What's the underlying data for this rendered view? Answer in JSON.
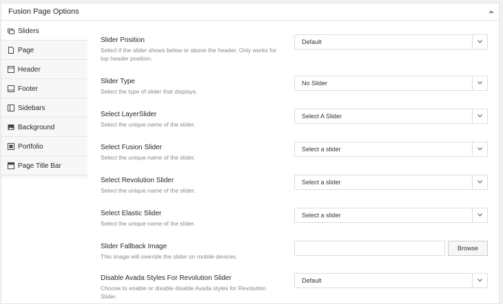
{
  "panel": {
    "title": "Fusion Page Options"
  },
  "sidebar": {
    "items": [
      {
        "label": "Sliders",
        "icon": "slides-icon"
      },
      {
        "label": "Page",
        "icon": "page-icon"
      },
      {
        "label": "Header",
        "icon": "header-icon"
      },
      {
        "label": "Footer",
        "icon": "footer-icon"
      },
      {
        "label": "Sidebars",
        "icon": "sidebars-icon"
      },
      {
        "label": "Background",
        "icon": "image-icon"
      },
      {
        "label": "Portfolio",
        "icon": "portfolio-icon"
      },
      {
        "label": "Page Title Bar",
        "icon": "title-bar-icon"
      }
    ]
  },
  "options": {
    "slider_position": {
      "title": "Slider Position",
      "desc": "Select if the slider shows below or above the header. Only works for top header position.",
      "value": "Default"
    },
    "slider_type": {
      "title": "Slider Type",
      "desc": "Select the type of slider that displays.",
      "value": "No Slider"
    },
    "layerslider": {
      "title": "Select LayerSlider",
      "desc": "Select the unique name of the slider.",
      "value": "Select A Slider"
    },
    "fusion_slider": {
      "title": "Select Fusion Slider",
      "desc": "Select the unique name of the slider.",
      "value": "Select a slider"
    },
    "revolution_slider": {
      "title": "Select Revolution Slider",
      "desc": "Select the unique name of the slider.",
      "value": "Select a slider"
    },
    "elastic_slider": {
      "title": "Select Elastic Slider",
      "desc": "Select the unique name of the slider.",
      "value": "Select a slider"
    },
    "fallback_image": {
      "title": "Slider Fallback Image",
      "desc": "This image will override the slider on mobile devices.",
      "value": "",
      "button": "Browse"
    },
    "avada_styles": {
      "title": "Disable Avada Styles For Revolution Slider",
      "desc": "Choose to enable or disable disable Avada styles for Revolution Slider.",
      "value": "Default"
    }
  }
}
